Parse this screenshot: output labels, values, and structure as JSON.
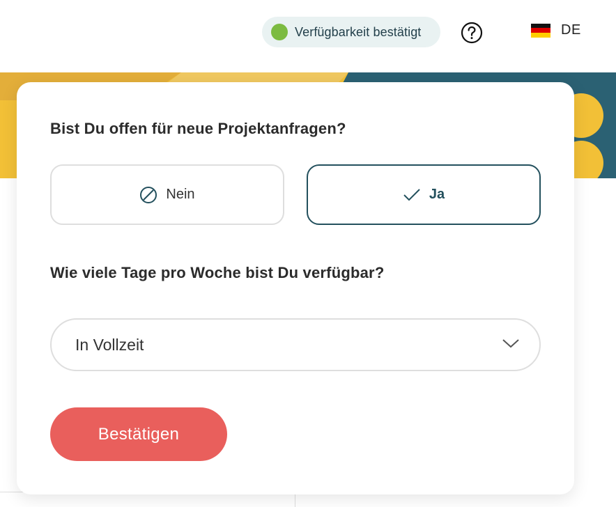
{
  "header": {
    "status_text": "Verfügbarkeit bestätigt",
    "status_color": "#7cbb41",
    "help_icon": "question-circle-icon",
    "language": "DE",
    "flag_icon": "germany-flag-icon"
  },
  "card": {
    "question_open": "Bist Du offen für neue Projektanfragen?",
    "option_no": "Nein",
    "option_yes": "Ja",
    "selected_option": "Ja",
    "question_days": "Wie viele Tage pro Woche bist Du verfügbar?",
    "days_selected": "In Vollzeit",
    "confirm_label": "Bestätigen"
  },
  "colors": {
    "accent_teal": "#23505d",
    "button_red": "#e95f5c",
    "banner_yellow": "#f2c037",
    "banner_teal": "#2b6173"
  }
}
